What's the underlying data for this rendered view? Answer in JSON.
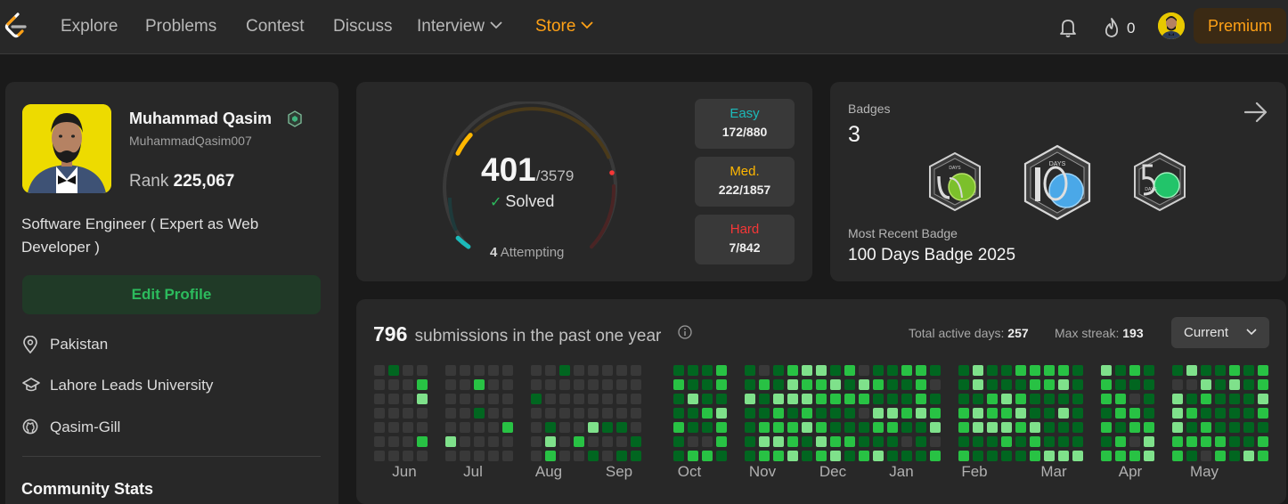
{
  "nav": {
    "links": [
      "Explore",
      "Problems",
      "Contest",
      "Discuss",
      "Interview",
      "Store"
    ],
    "streak_count": "0",
    "premium_label": "Premium",
    "accent_color": "#ffa116"
  },
  "profile": {
    "name": "Muhammad Qasim",
    "username": "MuhammadQasim007",
    "rank_label": "Rank",
    "rank_value": "225,067",
    "bio": "Software Engineer ( Expert as Web Developer )",
    "edit_label": "Edit Profile",
    "location": "Pakistan",
    "school": "Lahore Leads University",
    "github": "Qasim-Gill",
    "community_title": "Community Stats"
  },
  "solved": {
    "count": "401",
    "total": "/3579",
    "label": "Solved",
    "attempting_count": "4",
    "attempting_label": "Attempting",
    "easy": {
      "label": "Easy",
      "value": "172/880",
      "color": "#1cbaba"
    },
    "medium": {
      "label": "Med.",
      "value": "222/1857",
      "color": "#ffb700"
    },
    "hard": {
      "label": "Hard",
      "value": "7/842",
      "color": "#f63737"
    }
  },
  "badges": {
    "label": "Badges",
    "count": "3",
    "items": [
      "50 Days Badge",
      "100 Days Badge 2025",
      "50 Days Badge"
    ],
    "recent_label": "Most Recent Badge",
    "recent_value": "100 Days Badge 2025",
    "icon_text": "DAYS"
  },
  "submissions": {
    "count": "796",
    "title": "submissions in the past one year",
    "active_days_label": "Total active days:",
    "active_days": "257",
    "max_streak_label": "Max streak:",
    "max_streak": "193",
    "period_select": "Current",
    "months": [
      "Jun",
      "Jul",
      "Aug",
      "Sep",
      "Oct",
      "Nov",
      "Dec",
      "Jan",
      "Feb",
      "Mar",
      "Apr",
      "May"
    ],
    "level_colors": [
      "#393939",
      "#016620",
      "#28c244",
      "#7fe18b"
    ]
  }
}
